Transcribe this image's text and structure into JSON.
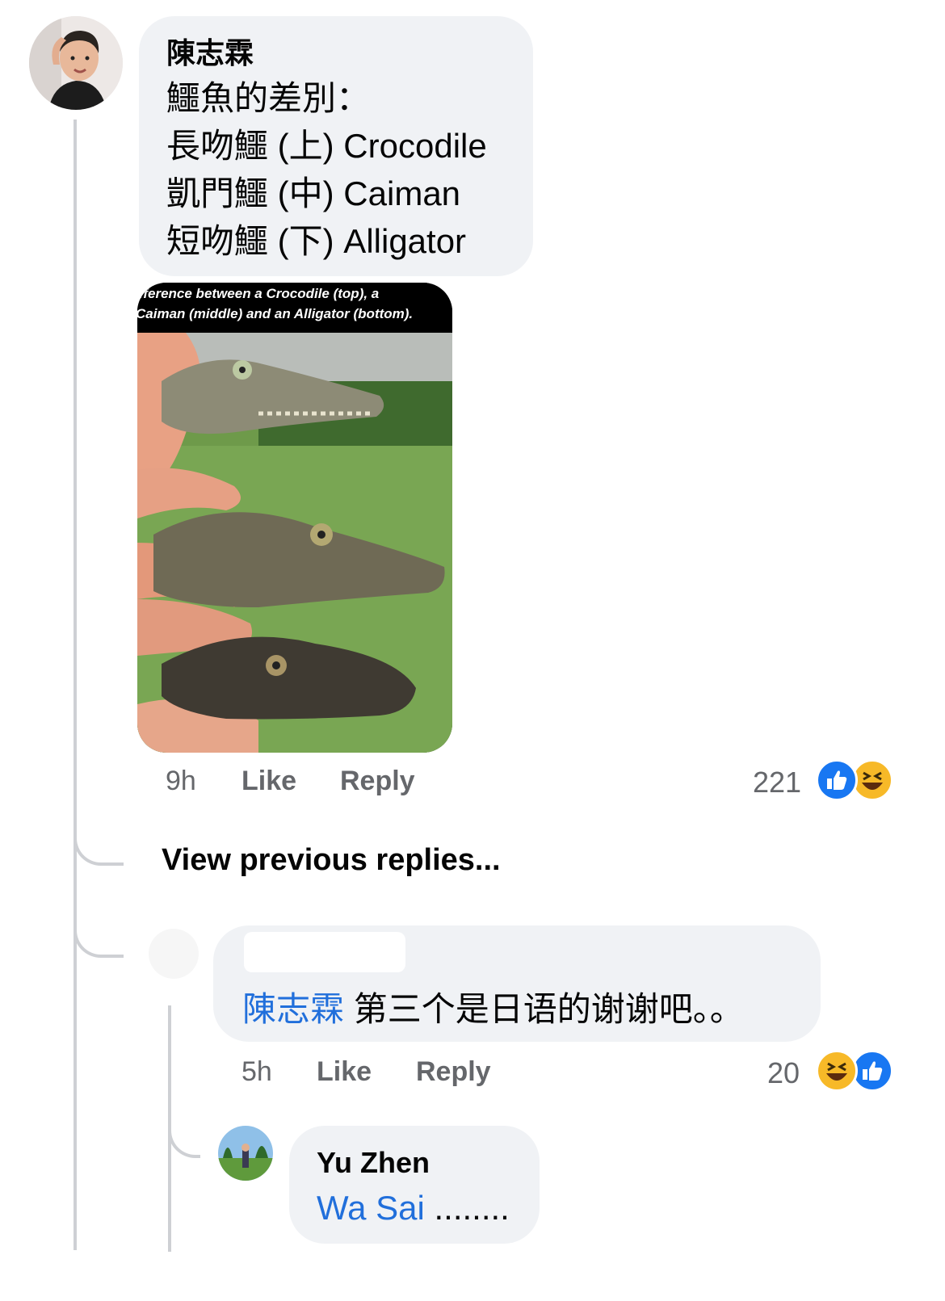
{
  "comment": {
    "author": "陳志霖",
    "lines": [
      "鱷魚的差別：",
      "長吻鱷 (上) Crocodile",
      "凱門鱷 (中) Caiman",
      "短吻鱷 (下) Alligator"
    ],
    "image_caption_1": "fference between a Crocodile (top), a",
    "image_caption_2": "Caiman (middle) and an Alligator (bottom).",
    "time": "9h",
    "like_label": "Like",
    "reply_label": "Reply",
    "reaction_count": "221",
    "reactions": [
      "like-icon",
      "haha-icon"
    ]
  },
  "view_previous": "View previous replies...",
  "reply1": {
    "mention": "陳志霖",
    "text": "第三个是日语的谢谢吧。。",
    "time": "5h",
    "like_label": "Like",
    "reply_label": "Reply",
    "reaction_count": "20",
    "reactions": [
      "haha-icon",
      "like-icon"
    ]
  },
  "reply2": {
    "author": "Yu Zhen",
    "mention": "Wa Sai",
    "text": "........"
  },
  "colors": {
    "link": "#216fdb",
    "meta": "#65676b",
    "bubble": "#f0f2f5",
    "like": "#1877f2",
    "haha": "#f7b928"
  }
}
